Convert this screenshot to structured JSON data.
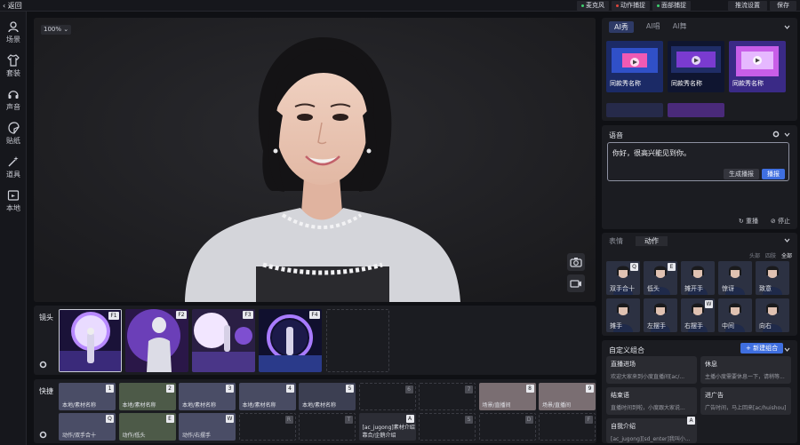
{
  "topbar": {
    "back_label": "返回",
    "toggles": [
      {
        "label": "麦克风",
        "color": "#3ecf6e"
      },
      {
        "label": "动作捕捉",
        "color": "#e0463c"
      },
      {
        "label": "面部捕捉",
        "color": "#3ecf6e"
      }
    ],
    "settings_label": "推流设置",
    "save_label": "保存"
  },
  "leftnav": {
    "items": [
      {
        "label": "场景",
        "icon": "person-icon"
      },
      {
        "label": "套装",
        "icon": "shirt-icon"
      },
      {
        "label": "声音",
        "icon": "headset-icon"
      },
      {
        "label": "贴纸",
        "icon": "sticker-icon"
      },
      {
        "label": "道具",
        "icon": "wand-icon"
      },
      {
        "label": "本地",
        "icon": "folder-icon"
      }
    ]
  },
  "stage": {
    "zoom": "100%"
  },
  "lens": {
    "title": "镜头",
    "cells": [
      {
        "key": "F1"
      },
      {
        "key": "F2"
      },
      {
        "key": "F3"
      },
      {
        "key": "F4"
      }
    ]
  },
  "shortcut": {
    "title": "快捷",
    "row1": [
      {
        "key": "1",
        "label": "本地/素材名称"
      },
      {
        "key": "2",
        "label": "本地/素材名称"
      },
      {
        "key": "3",
        "label": "本地/素材名称"
      },
      {
        "key": "4",
        "label": "本地/素材名称"
      },
      {
        "key": "5",
        "label": "本地/素材名称"
      },
      {
        "key": "6",
        "label": ""
      },
      {
        "key": "7",
        "label": ""
      },
      {
        "key": "8",
        "label": "场景/直播间"
      },
      {
        "key": "9",
        "label": "场景/直播间"
      }
    ],
    "row2": [
      {
        "key": "Q",
        "label": "动作/双手合十"
      },
      {
        "key": "E",
        "label": "动作/低头"
      },
      {
        "key": "W",
        "label": "动作/右摆手"
      },
      {
        "key": "R",
        "label": ""
      },
      {
        "key": "T",
        "label": ""
      },
      {
        "key": "A",
        "label": "[ac_jugong]素材介绍\n靠合/企鹅介绍"
      },
      {
        "key": "S",
        "label": ""
      },
      {
        "key": "D",
        "label": ""
      },
      {
        "key": "F",
        "label": ""
      }
    ]
  },
  "ai_panel": {
    "tabs": [
      "AI秀",
      "AI唱",
      "AI舞"
    ],
    "thumbs": [
      "同款秀名称",
      "同款秀名称",
      "同款秀名称"
    ]
  },
  "voice_panel": {
    "title": "语音",
    "text": "你好，很高兴能见到你。",
    "generate_label": "生成播报",
    "play_label": "播报",
    "replay_label": "重播",
    "stop_label": "停止"
  },
  "action_panel": {
    "tabs": [
      "表情",
      "动作"
    ],
    "filters": [
      "头部",
      "四肢",
      "全部"
    ],
    "items": [
      {
        "label": "双手合十",
        "key": "Q"
      },
      {
        "label": "低头",
        "key": "E"
      },
      {
        "label": "摊开手",
        "key": ""
      },
      {
        "label": "惊讶",
        "key": ""
      },
      {
        "label": "致意",
        "key": ""
      },
      {
        "label": "摊手",
        "key": ""
      },
      {
        "label": "左摆手",
        "key": ""
      },
      {
        "label": "右摆手",
        "key": "W"
      },
      {
        "label": "中间",
        "key": ""
      },
      {
        "label": "向右",
        "key": ""
      }
    ]
  },
  "combo_panel": {
    "title": "自定义组合",
    "new_label": "+ 新建组合",
    "items": [
      {
        "title": "直播进场",
        "desc": "欢迎大家来到小度直播间[ac/..."
      },
      {
        "title": "休息",
        "desc": "主播小度需要休息一下，请稍等..."
      },
      {
        "title": "结束语",
        "desc": "直播时间到啦，小度跟大家说..."
      },
      {
        "title": "进广告",
        "desc": "广告时间，马上回来[ac/huishou]"
      },
      {
        "title": "自我介绍",
        "desc": "[ac_jugong][sd_enter]我叫小...",
        "key": "A"
      }
    ]
  },
  "colors": {
    "accent": "#3f6fe0",
    "panel": "#1b1c21",
    "bg": "#0f1014"
  }
}
